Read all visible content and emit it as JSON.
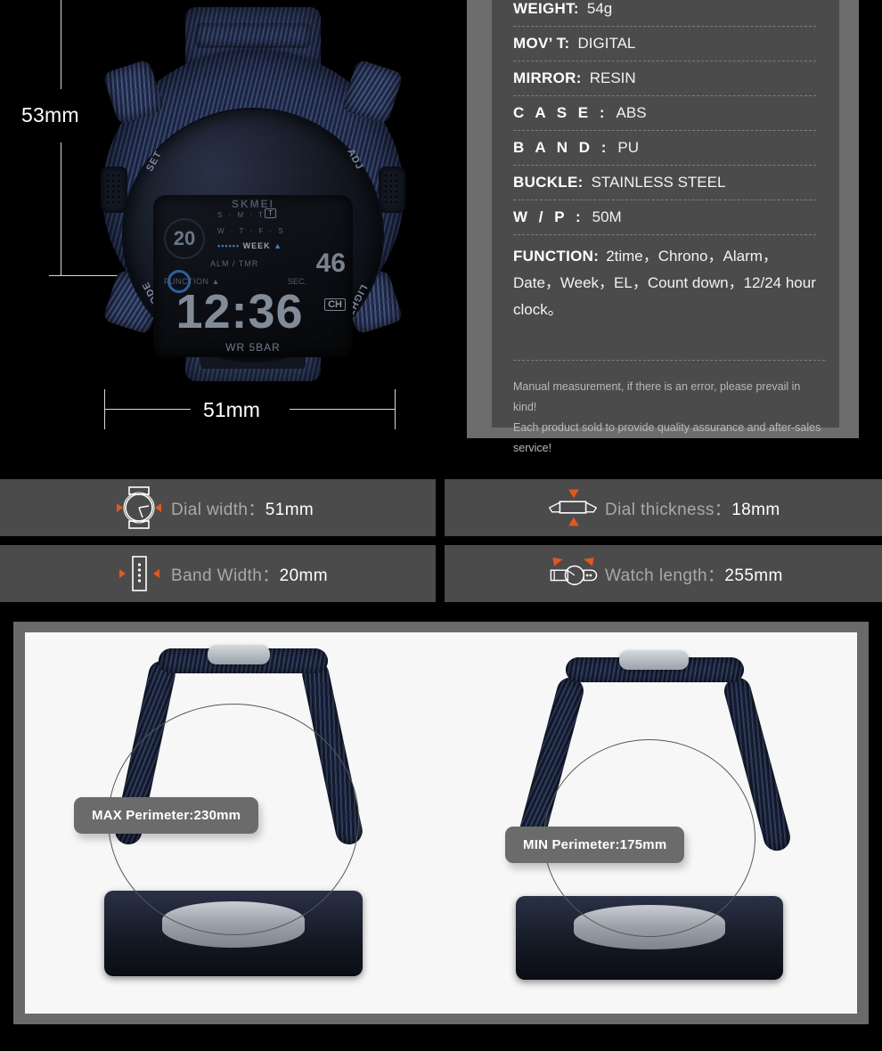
{
  "dimensions": {
    "height_label": "53mm",
    "width_label": "51mm"
  },
  "watch_face": {
    "brand": "SKMEI",
    "date": "20",
    "weekday_row_1": "S · M · T",
    "weekday_row_2": "W · T · F · S",
    "week_label": "WEEK",
    "alarm_timer": "ALM / TMR",
    "seconds_value": "46",
    "function_label": "FUNCTION",
    "sec_label": "SEC.",
    "time": "12:36",
    "ch_label": "CH",
    "water_resist": "WR 5BAR",
    "bezel_set": "SET",
    "bezel_adj": "ADJ",
    "bezel_mode": "MODE",
    "bezel_light": "LIGHT"
  },
  "spec": {
    "rows": [
      {
        "key": "WEIGHT:",
        "value": "54g",
        "spaced": false
      },
      {
        "key": "MOV’ T:",
        "value": "DIGITAL",
        "spaced": false
      },
      {
        "key": "MIRROR:",
        "value": "RESIN",
        "spaced": false
      },
      {
        "key": "C A S E :",
        "value": "ABS",
        "spaced": true
      },
      {
        "key": "B A N D :",
        "value": "PU",
        "spaced": true
      },
      {
        "key": "BUCKLE:",
        "value": "STAINLESS STEEL",
        "spaced": false
      },
      {
        "key": "W / P :",
        "value": "50M",
        "spaced": true
      }
    ],
    "function_key": "FUNCTION:",
    "function_value": "2time，Chrono，Alarm，Date，Week，EL，Count down，12/24 hour clock。",
    "notes": [
      "Manual measurement, if there is an error, please prevail in kind!",
      "Each product sold to provide quality assurance and after-sales service!"
    ]
  },
  "measurements": [
    {
      "icon": "dial-width-icon",
      "label": "Dial width：",
      "value": "51mm"
    },
    {
      "icon": "dial-thickness-icon",
      "label": "Dial thickness：",
      "value": "18mm"
    },
    {
      "icon": "band-width-icon",
      "label": "Band Width：",
      "value": "20mm"
    },
    {
      "icon": "watch-length-icon",
      "label": "Watch length：",
      "value": "255mm"
    }
  ],
  "perimeters": [
    {
      "label": "MAX Perimeter:230mm"
    },
    {
      "label": "MIN Perimeter:175mm"
    }
  ],
  "colors": {
    "background": "#000000",
    "panel_outer": "#6d6d6d",
    "panel_inner": "#4b4b4b",
    "accent_orange": "#e2581f",
    "label_gray": "#a9a9a9",
    "photo_bg": "#f7f7f7"
  }
}
